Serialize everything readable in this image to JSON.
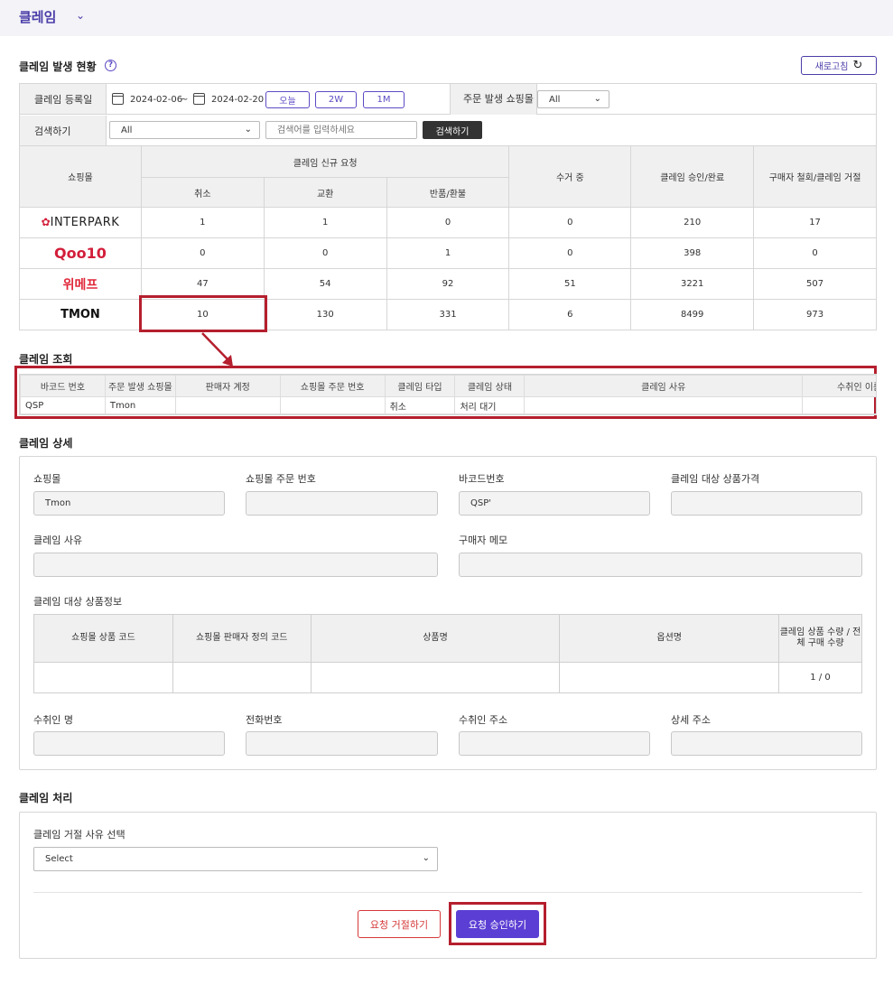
{
  "app": {
    "title": "클레임"
  },
  "status": {
    "title": "클레임 발생 현황",
    "refresh_label": "새로고침",
    "filter": {
      "reg_date_label": "클레임 등록일",
      "date_from": "2024-02-06",
      "date_sep": "~",
      "date_to": "2024-02-20",
      "btn_today": "오늘",
      "btn_2w": "2W",
      "btn_1m": "1M",
      "mall_label": "주문 발생 쇼핑몰",
      "mall_value": "All",
      "search_label": "검색하기",
      "search_select": "All",
      "search_placeholder": "검색어를 입력하세요",
      "search_button": "검색하기"
    },
    "table": {
      "col_mall": "쇼핑몰",
      "col_new": "클레임 신규 요청",
      "col_cancel": "취소",
      "col_exchange": "교환",
      "col_return": "반품/환불",
      "col_collect": "수거 중",
      "col_approved": "클레임 승인/완료",
      "col_withdrawn": "구매자 철회/클레임 거절",
      "rows": [
        {
          "brand": "INTERPARK",
          "cancel": "1",
          "exchange": "1",
          "return": "0",
          "collect": "0",
          "approved": "210",
          "withdrawn": "17"
        },
        {
          "brand": "Qoo10",
          "cancel": "0",
          "exchange": "0",
          "return": "1",
          "collect": "0",
          "approved": "398",
          "withdrawn": "0"
        },
        {
          "brand": "위메프",
          "cancel": "47",
          "exchange": "54",
          "return": "92",
          "collect": "51",
          "approved": "3221",
          "withdrawn": "507"
        },
        {
          "brand": "TMON",
          "cancel": "10",
          "exchange": "130",
          "return": "331",
          "collect": "6",
          "approved": "8499",
          "withdrawn": "973"
        }
      ]
    }
  },
  "lookup": {
    "title": "클레임 조회",
    "headers": [
      "바코드 번호",
      "주문 발생 쇼핑몰",
      "판매자 계정",
      "쇼핑몰 주문 번호",
      "클레임 타입",
      "클레임 상태",
      "클레임 사유",
      "수취인 이름"
    ],
    "row": [
      "QSP",
      "Tmon",
      "",
      "",
      "취소",
      "처리 대기",
      "",
      ""
    ]
  },
  "detail": {
    "title": "클레임 상세",
    "mall_label": "쇼핑몰",
    "mall_value": "Tmon",
    "order_no_label": "쇼핑몰 주문 번호",
    "order_no_value": "",
    "barcode_label": "바코드번호",
    "barcode_value": "QSP'",
    "price_label": "클레임 대상 상품가격",
    "price_value": "",
    "reason_label": "클레임 사유",
    "memo_label": "구매자 메모",
    "product_info_label": "클레임 대상 상품정보",
    "product_table": {
      "headers": [
        "쇼핑몰 상품 코드",
        "쇼핑몰 판매자 정의 코드",
        "상품명",
        "옵션명",
        "클레임 상품 수량 / 전체 구매 수량"
      ],
      "row": [
        "",
        "",
        "",
        "",
        "1 / 0"
      ]
    },
    "recipient_label": "수취인 명",
    "phone_label": "전화번호",
    "address_label": "수취인 주소",
    "address_detail_label": "상세 주소"
  },
  "process": {
    "title": "클레임 처리",
    "reject_reason_label": "클레임 거절 사유 선택",
    "reject_reason_value": "Select",
    "reject_button": "요청 거절하기",
    "approve_button": "요청 승인하기"
  },
  "colors": {
    "accent": "#5b3fd4",
    "highlight": "#b51f2e"
  }
}
